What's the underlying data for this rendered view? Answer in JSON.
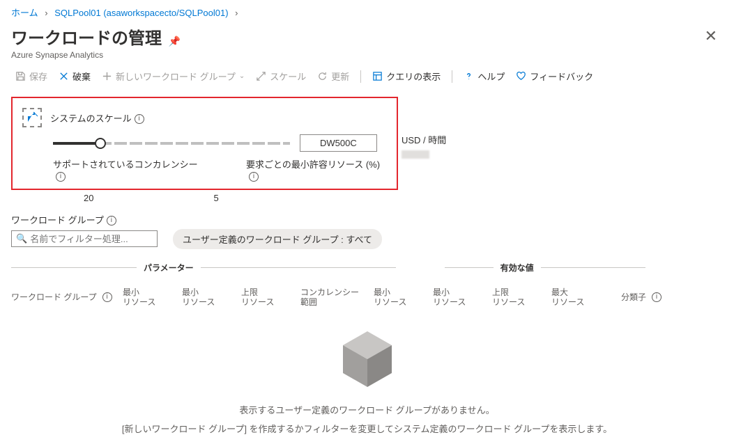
{
  "breadcrumb": {
    "home": "ホーム",
    "item": "SQLPool01 (asaworkspacecto/SQLPool01)"
  },
  "header": {
    "title": "ワークロードの管理",
    "subtitle": "Azure Synapse Analytics"
  },
  "toolbar": {
    "save": "保存",
    "discard": "破棄",
    "newGroup": "新しいワークロード グループ",
    "scale": "スケール",
    "refresh": "更新",
    "showQuery": "クエリの表示",
    "help": "ヘルプ",
    "feedback": "フィードバック"
  },
  "scale": {
    "label": "システムのスケール",
    "value": "DW500C",
    "concurrencyLabel": "サポートされているコンカレンシー",
    "concurrencyValue": "20",
    "minResourceLabel": "要求ごとの最小許容リソース (%)",
    "minResourceValue": "5",
    "usdLabel": "USD / 時間"
  },
  "workloadGroup": {
    "label": "ワークロード グループ",
    "filterPlaceholder": "名前でフィルター処理...",
    "pill": "ユーザー定義のワークロード グループ : すべて"
  },
  "gridSections": {
    "parameters": "パラメーター",
    "effective": "有効な値"
  },
  "columns": {
    "group": "ワークロード グループ",
    "minResource1": "最小\nリソース",
    "minResource2": "最小\nリソース",
    "capResource1": "上限\nリソース",
    "concurrencyRange": "コンカレンシー\n範囲",
    "minResource3": "最小\nリソース",
    "minResource4": "最小\nリソース",
    "capResource2": "上限\nリソース",
    "maxResource": "最大\nリソース",
    "classifier": "分類子"
  },
  "empty": {
    "line1": "表示するユーザー定義のワークロード グループがありません。",
    "line2": "[新しいワークロード グループ] を作成するかフィルターを変更してシステム定義のワークロード グループを表示します。"
  }
}
